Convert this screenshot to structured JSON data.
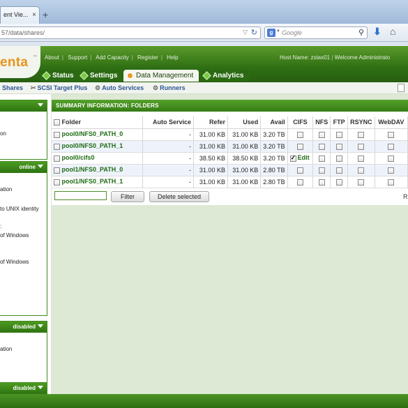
{
  "browser": {
    "tab_title": "ent Vie...",
    "tab_close": "×",
    "new_tab": "+",
    "url": "57/data/shares/",
    "search_placeholder": "Google",
    "search_engine_glyph": "g"
  },
  "app": {
    "logo_text": "enta",
    "logo_tm": "™",
    "top_links": [
      "About",
      "Support",
      "Add Capacity",
      "Register",
      "Help"
    ],
    "host_label": "Host Name: zstax01",
    "welcome": "Welcome Administrato",
    "main_tabs": [
      {
        "label": "Status",
        "active": false
      },
      {
        "label": "Settings",
        "active": false
      },
      {
        "label": "Data Management",
        "active": true
      },
      {
        "label": "Analytics",
        "active": false
      }
    ],
    "sub_nav": [
      {
        "label": "Shares",
        "icon": "shares-icon"
      },
      {
        "label": "SCSI Target Plus",
        "icon": "tools-icon"
      },
      {
        "label": "Auto Services",
        "icon": "gear-icon"
      },
      {
        "label": "Runners",
        "icon": "runner-icon"
      }
    ]
  },
  "sidebar": {
    "panel1": {
      "status": "",
      "items": [
        "on"
      ]
    },
    "panel2": {
      "status": "online",
      "items": [
        "ation",
        "to UNIX identity",
        ":",
        "of Windows",
        "of Windows"
      ]
    },
    "panel3": {
      "status": "disabled",
      "items": [
        "ation"
      ]
    },
    "panel4": {
      "status": "disabled"
    }
  },
  "summary": {
    "title": "SUMMARY INFORMATION: FOLDERS",
    "columns": [
      "Folder",
      "Auto Service",
      "Refer",
      "Used",
      "Avail",
      "CIFS",
      "NFS",
      "FTP",
      "RSYNC",
      "WebDAV"
    ],
    "rows": [
      {
        "folder": "pool0/NFS0_PATH_0",
        "auto": "-",
        "refer": "31.00 KB",
        "used": "31.00 KB",
        "avail": "3.20 TB",
        "cifs": false,
        "cifs_edit": ""
      },
      {
        "folder": "pool0/NFS0_PATH_1",
        "auto": "-",
        "refer": "31.00 KB",
        "used": "31.00 KB",
        "avail": "3.20 TB",
        "cifs": false,
        "cifs_edit": ""
      },
      {
        "folder": "pool0/cifs0",
        "auto": "-",
        "refer": "38.50 KB",
        "used": "38.50 KB",
        "avail": "3.20 TB",
        "cifs": true,
        "cifs_edit": "Edit"
      },
      {
        "folder": "pool1/NFS0_PATH_0",
        "auto": "-",
        "refer": "31.00 KB",
        "used": "31.00 KB",
        "avail": "2.80 TB",
        "cifs": false,
        "cifs_edit": ""
      },
      {
        "folder": "pool1/NFS0_PATH_1",
        "auto": "-",
        "refer": "31.00 KB",
        "used": "31.00 KB",
        "avail": "2.80 TB",
        "cifs": false,
        "cifs_edit": ""
      }
    ],
    "filter_button": "Filter",
    "delete_button": "Delete selected",
    "right_edge_text": "R"
  }
}
